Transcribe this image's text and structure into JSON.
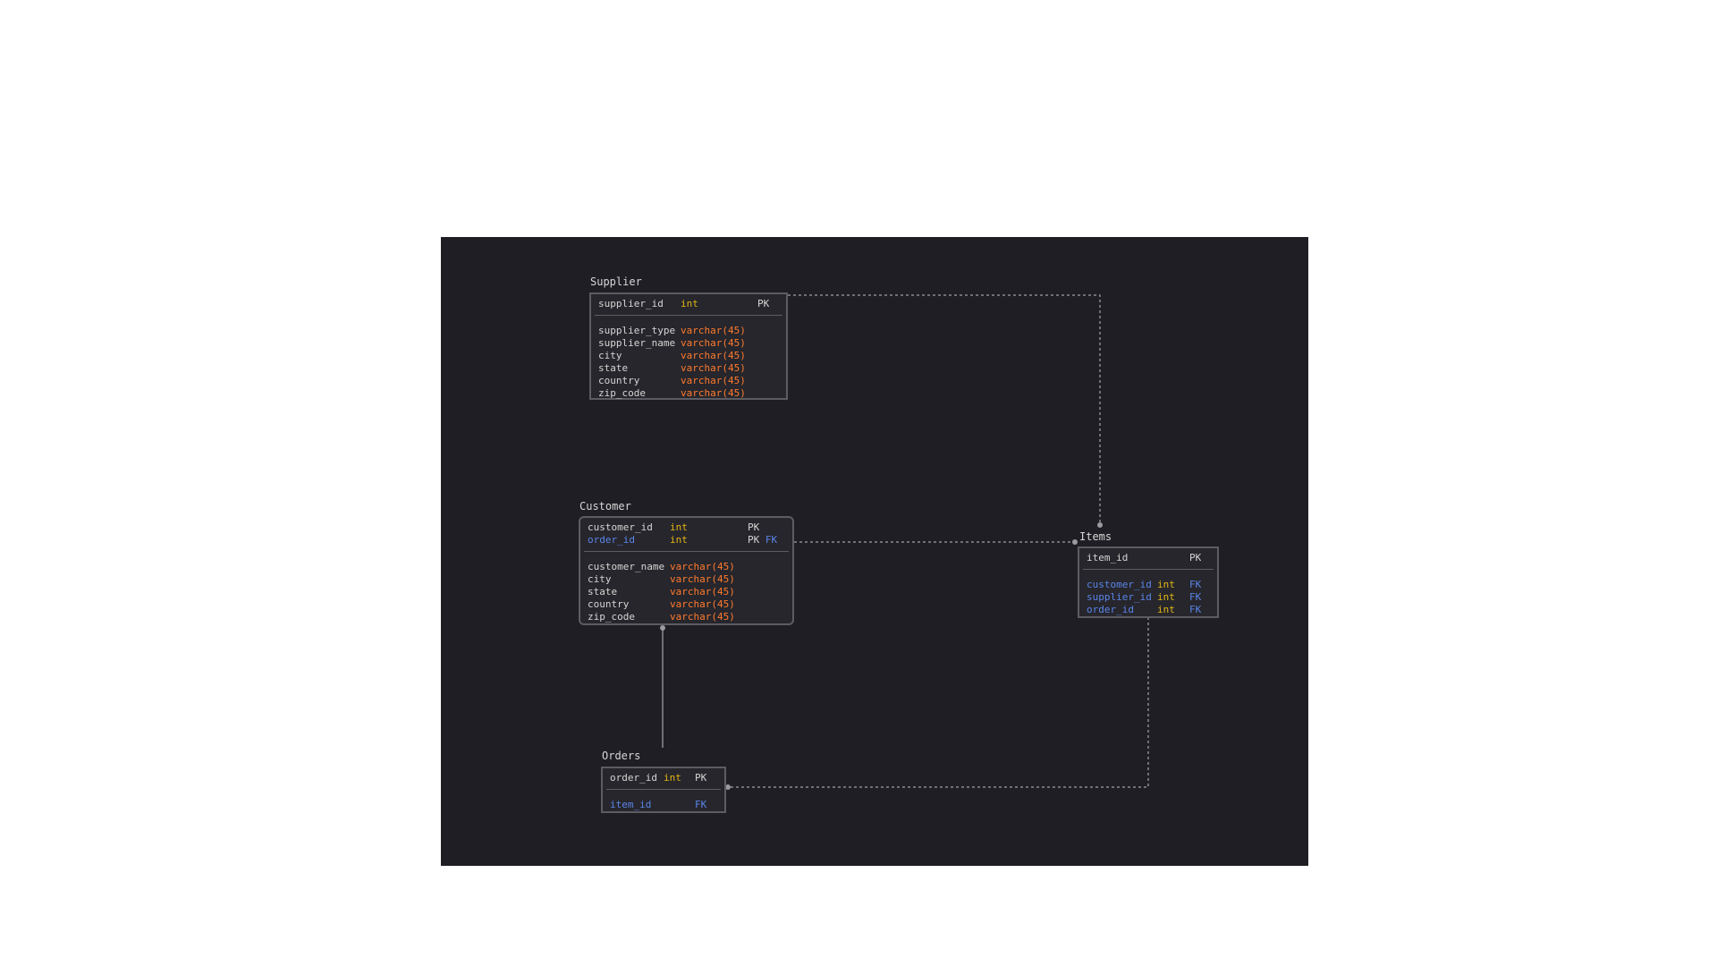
{
  "diagram": {
    "tables": {
      "supplier": {
        "title": "Supplier",
        "pk_rows": [
          {
            "name": "supplier_id",
            "type": "int",
            "key": "PK",
            "fk": ""
          }
        ],
        "rows": [
          {
            "name": "supplier_type",
            "type": "varchar(45)"
          },
          {
            "name": "supplier_name",
            "type": "varchar(45)"
          },
          {
            "name": "city",
            "type": "varchar(45)"
          },
          {
            "name": "state",
            "type": "varchar(45)"
          },
          {
            "name": "country",
            "type": "varchar(45)"
          },
          {
            "name": "zip_code",
            "type": "varchar(45)"
          }
        ]
      },
      "customer": {
        "title": "Customer",
        "pk_rows": [
          {
            "name": "customer_id",
            "type": "int",
            "key": "PK",
            "fk": ""
          },
          {
            "name": "order_id",
            "type": "int",
            "key": "PK",
            "fk": "FK"
          }
        ],
        "rows": [
          {
            "name": "customer_name",
            "type": "varchar(45)"
          },
          {
            "name": "city",
            "type": "varchar(45)"
          },
          {
            "name": "state",
            "type": "varchar(45)"
          },
          {
            "name": "country",
            "type": "varchar(45)"
          },
          {
            "name": "zip_code",
            "type": "varchar(45)"
          }
        ]
      },
      "items": {
        "title": "Items",
        "pk_rows": [
          {
            "name": "item_id",
            "type": "",
            "key": "PK",
            "fk": ""
          }
        ],
        "rows": [
          {
            "name": "customer_id",
            "type": "int",
            "key": "FK"
          },
          {
            "name": "supplier_id",
            "type": "int",
            "key": "FK"
          },
          {
            "name": "order_id",
            "type": "int",
            "key": "FK"
          }
        ]
      },
      "orders": {
        "title": "Orders",
        "pk_rows": [
          {
            "name": "order_id",
            "type": "int",
            "key": "PK",
            "fk": ""
          }
        ],
        "rows": [
          {
            "name": "item_id",
            "type": "",
            "key": "FK"
          }
        ]
      }
    },
    "colors": {
      "background": "#1e1e24",
      "box": "#26262c",
      "border": "#5c5c62",
      "text": "#d6d6d6",
      "int_type": "#e2b514",
      "varchar_type": "#ff7a2e",
      "foreign_key": "#5b84e8",
      "connector": "#8a8a90"
    }
  }
}
